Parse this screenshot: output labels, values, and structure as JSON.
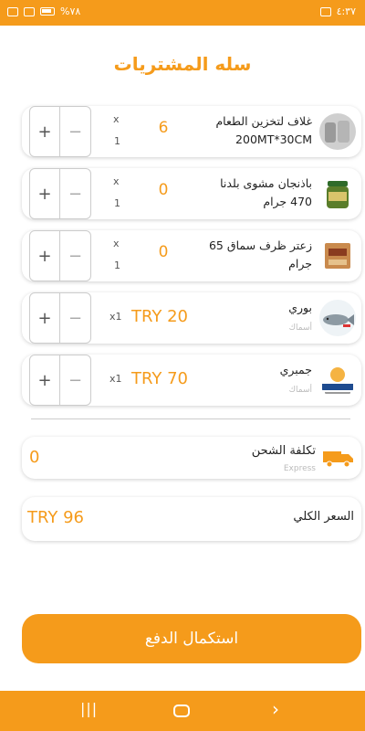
{
  "status_bar": {
    "time": "٤:٣٧",
    "battery": "%٧٨"
  },
  "page": {
    "title": "سله المشتريات"
  },
  "items": [
    {
      "name_line1": "غلاف لتخزين الطعام",
      "name_line2": "200MT*30CM",
      "qty": "6",
      "x": "x",
      "count": "1",
      "thumb": "food-storage-roll"
    },
    {
      "name_line1": "باذنجان مشوى بلدنا",
      "name_line2": "470 جرام",
      "qty": "0",
      "x": "x",
      "count": "1",
      "thumb": "eggplant-jar"
    },
    {
      "name_line1": "زعتر ظرف سماق 65",
      "name_line2": "جرام",
      "qty": "0",
      "x": "x",
      "count": "1",
      "thumb": "zaatar-pack"
    },
    {
      "name_line1": "بوري",
      "sub": "أسماك",
      "price": "TRY 20",
      "times": "x1",
      "thumb": "fish"
    },
    {
      "name_line1": "جمبري",
      "sub": "أسماك",
      "price": "TRY 70",
      "times": "x1",
      "thumb": "shrimp-logo"
    }
  ],
  "stepper": {
    "plus": "+",
    "minus": "−"
  },
  "shipping": {
    "label": "تكلفة الشحن",
    "sub": "Express",
    "value": "0"
  },
  "total": {
    "label": "السعر الكلي",
    "value": "TRY 96"
  },
  "checkout": {
    "label": "استكمال الدفع"
  },
  "colors": {
    "accent": "#f59b1b"
  }
}
